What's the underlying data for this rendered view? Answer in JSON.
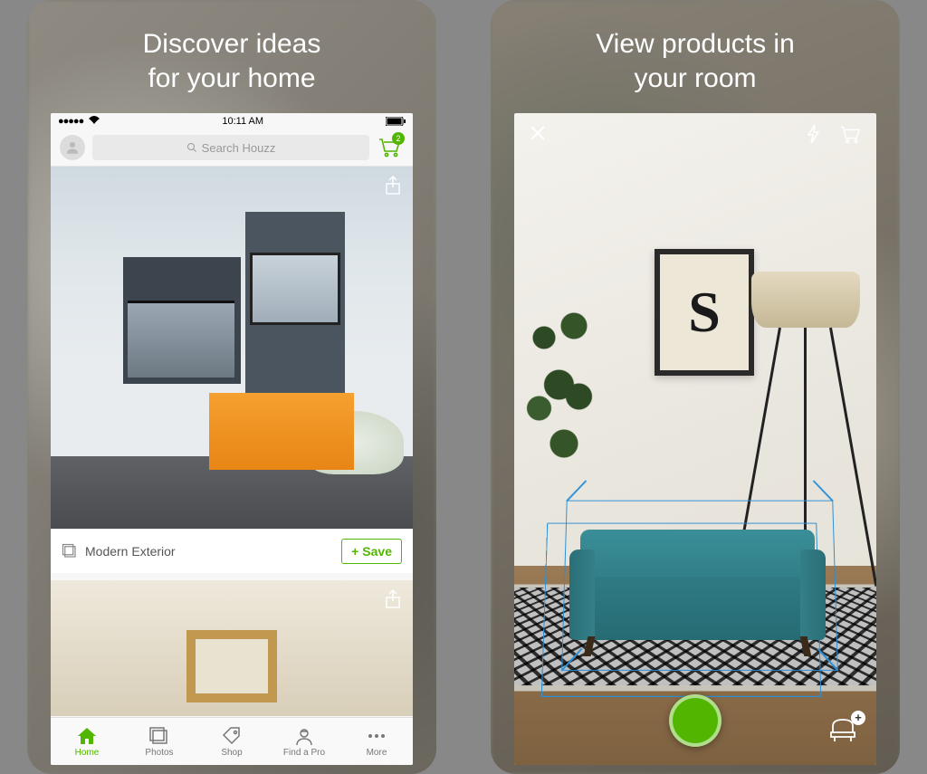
{
  "left": {
    "title": "Discover ideas\nfor your home",
    "status_time": "10:11 AM",
    "search_placeholder": "Search Houzz",
    "cart_count": "2",
    "card_label": "Modern Exterior",
    "save_label": "Save",
    "tabs": [
      {
        "label": "Home"
      },
      {
        "label": "Photos"
      },
      {
        "label": "Shop"
      },
      {
        "label": "Find a Pro"
      },
      {
        "label": "More"
      }
    ]
  },
  "right": {
    "title": "View products in\nyour room",
    "art_text": "S"
  }
}
